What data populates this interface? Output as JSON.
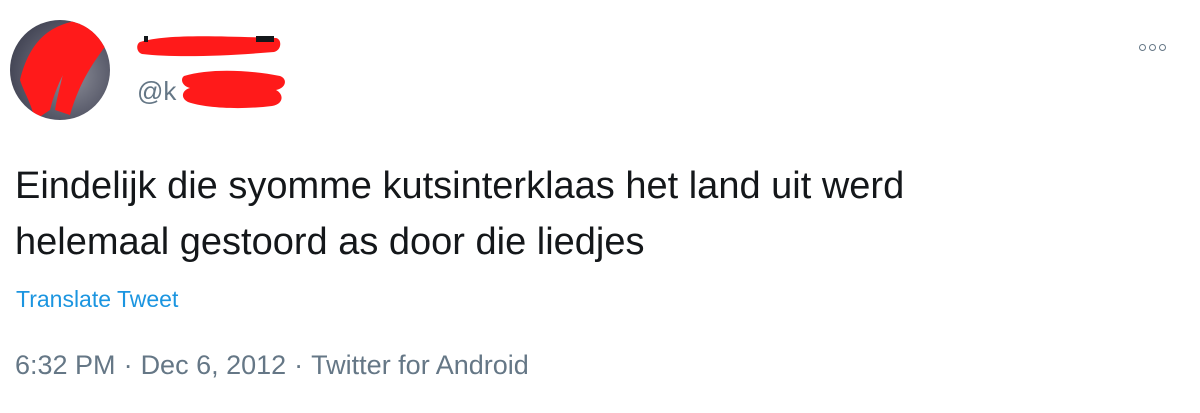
{
  "user": {
    "display_name": "",
    "handle": "@k"
  },
  "menu": {
    "more_icon": "more-dots-icon"
  },
  "tweet": {
    "text_lines": [
      "Eindelijk die syomme kutsinterklaas het land uit werd",
      "helemaal gestoord as door die liedjes"
    ],
    "translate_label": "Translate Tweet",
    "time": "6:32 PM",
    "separator": "·",
    "date": "Dec 6, 2012",
    "source": "Twitter for Android"
  },
  "colors": {
    "redaction": "#ff1a1a",
    "link": "#1b95e0",
    "secondary_text": "#657786",
    "primary_text": "#14171a"
  }
}
